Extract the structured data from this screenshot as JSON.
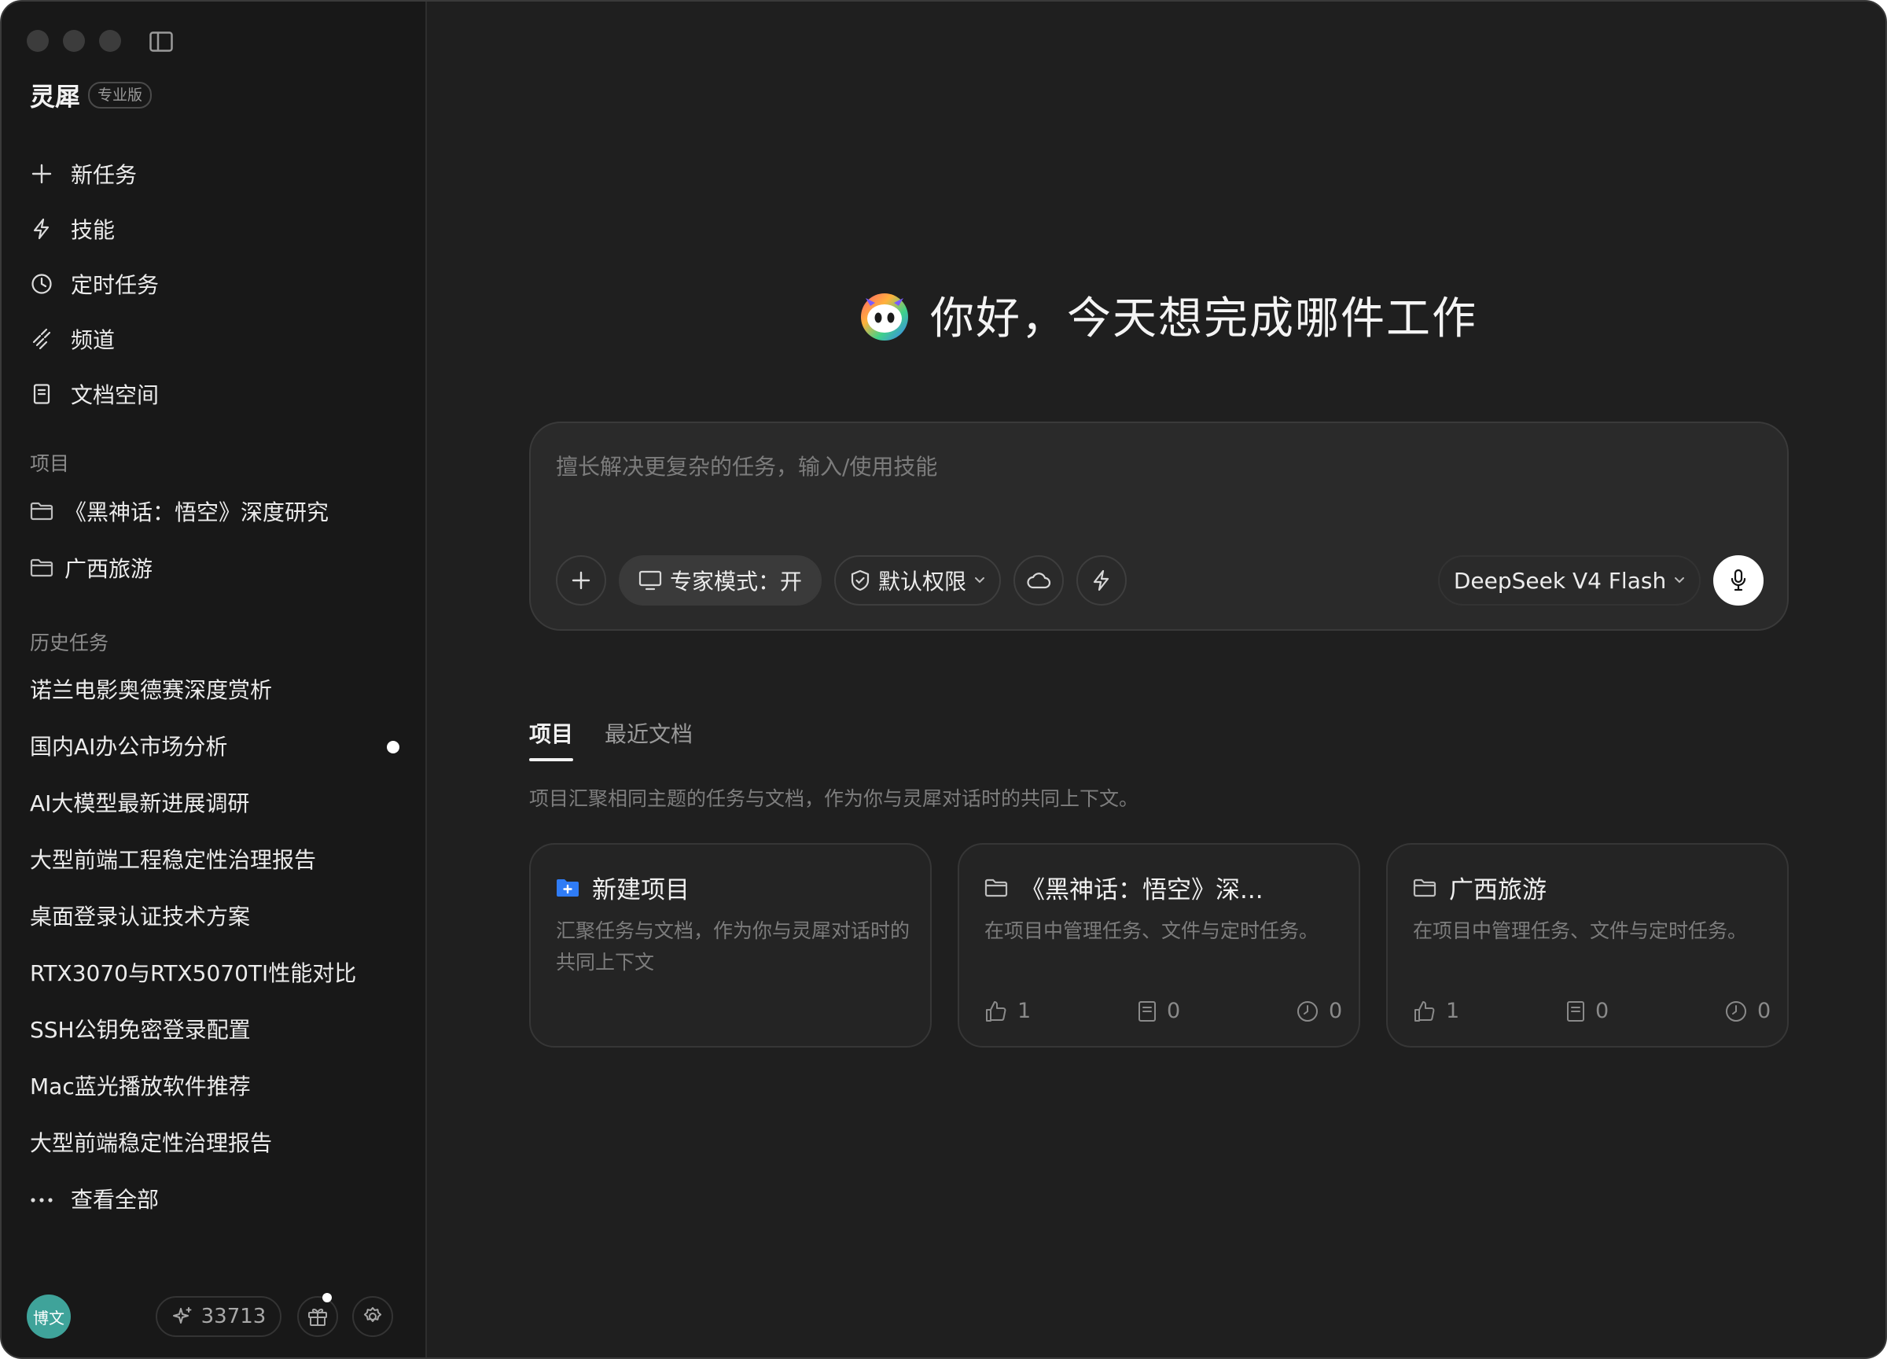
{
  "app": {
    "name": "灵犀",
    "edition": "专业版"
  },
  "nav": [
    {
      "label": "新任务",
      "icon": "plus-icon"
    },
    {
      "label": "技能",
      "icon": "bolt-icon"
    },
    {
      "label": "定时任务",
      "icon": "clock-icon"
    },
    {
      "label": "频道",
      "icon": "channel-icon"
    },
    {
      "label": "文档空间",
      "icon": "document-icon"
    }
  ],
  "projects_section": {
    "label": "项目",
    "items": [
      "《黑神话：悟空》深度研究",
      "广西旅游"
    ]
  },
  "history_section": {
    "label": "历史任务",
    "items": [
      "诺兰电影奥德赛深度赏析",
      "国内AI办公市场分析",
      "AI大模型最新进展调研",
      "大型前端工程稳定性治理报告",
      "桌面登录认证技术方案",
      "RTX3070与RTX5070TI性能对比",
      "SSH公钥免密登录配置",
      "Mac蓝光播放软件推荐",
      "大型前端稳定性治理报告"
    ],
    "unread_index": 1,
    "view_all": "查看全部"
  },
  "footer": {
    "avatar_text": "博文",
    "credits": "33713"
  },
  "greeting": "你好，今天想完成哪件工作",
  "composer": {
    "placeholder": "擅长解决更复杂的任务，输入/使用技能",
    "expert_mode": "专家模式：开",
    "permission": "默认权限",
    "model": "DeepSeek V4 Flash"
  },
  "tabs": [
    "项目",
    "最近文档"
  ],
  "tab_description": "项目汇聚相同主题的任务与文档，作为你与灵犀对话时的共同上下文。",
  "cards": [
    {
      "title": "新建项目",
      "description": "汇聚任务与文档，作为你与灵犀对话时的共同上下文"
    },
    {
      "title": "《黑神话：悟空》深...",
      "description": "在项目中管理任务、文件与定时任务。",
      "tasks": "1",
      "docs": "0",
      "schedules": "0"
    },
    {
      "title": "广西旅游",
      "description": "在项目中管理任务、文件与定时任务。",
      "tasks": "1",
      "docs": "0",
      "schedules": "0"
    }
  ],
  "colors": {
    "background": "#1f1f1f",
    "sidebar": "#181818",
    "accent_blue": "#2f7cf6",
    "avatar": "#3fa39a"
  }
}
